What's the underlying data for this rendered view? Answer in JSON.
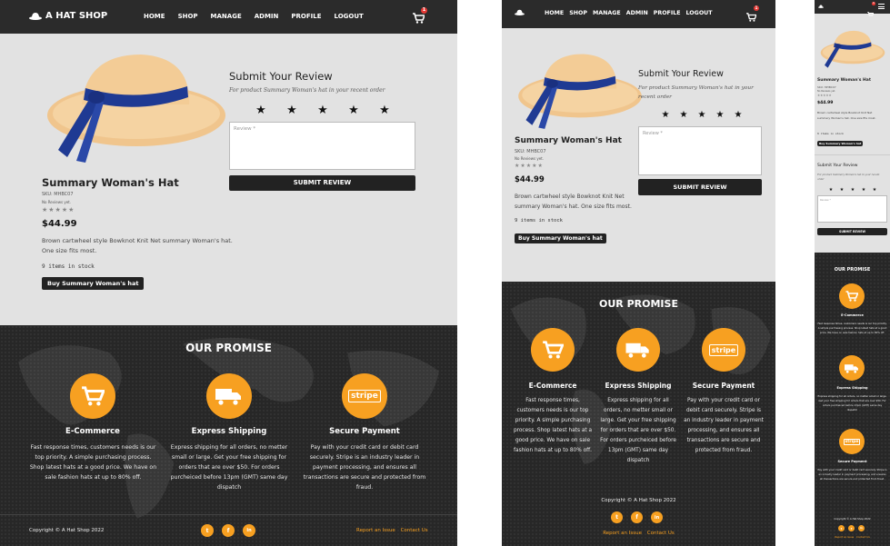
{
  "brand": {
    "name": "A HAT SHOP",
    "accent": "#f7a021",
    "dark": "#2b2b2b"
  },
  "nav": {
    "items": [
      "HOME",
      "SHOP",
      "MANAGE",
      "ADMIN",
      "PROFILE",
      "LOGOUT"
    ],
    "cart_count": "1",
    "cart_icon": "cart-icon",
    "menu_icon": "hamburger-icon"
  },
  "product": {
    "name": "Summary Woman's Hat",
    "sku": "SKU: MHBC07",
    "reviews": "No Reviews yet.",
    "stars": "★★★★★",
    "price": "$44.99",
    "description": "Brown cartwheel style Bowknot Knit Net summary Woman's hat. One size fits most.",
    "stock": "9 items in stock",
    "buy_label": "Buy Summary Woman's hat"
  },
  "review": {
    "title": "Submit Your Review",
    "subtitle": "For product Summary Woman's hat in your recent order",
    "rating_stars": [
      "★",
      "★",
      "★",
      "★",
      "★"
    ],
    "placeholder": "Review *",
    "submit_label": "SUBMIT REVIEW"
  },
  "promise": {
    "heading": "OUR PROMISE",
    "items": [
      {
        "title": "E-Commerce",
        "icon": "cart-icon",
        "text": "Fast response times, customers needs is our top priority. A simple purchasing process. Shop latest hats at a good price. We have on sale fashion hats at up to 80% off."
      },
      {
        "title": "Express Shipping",
        "icon": "truck-icon",
        "text": "Express shipping for all orders, no metter small or large. Get your free shipping for orders that are over $50. For orders purcheiced before 13pm (GMT) same day dispatch"
      },
      {
        "title": "Secure Payment",
        "icon": "stripe-icon",
        "stripe": "stripe",
        "text": "Pay with your credit card or debit card securely. Stripe is an industry leader in payment processing, and ensures all transactions are secure and protected from fraud."
      }
    ]
  },
  "footer": {
    "copyright": "Copyright © A Hat Shop 2022",
    "socials": [
      "t",
      "f",
      "in"
    ],
    "report": "Report an Issue",
    "contact": "Contact Us"
  }
}
